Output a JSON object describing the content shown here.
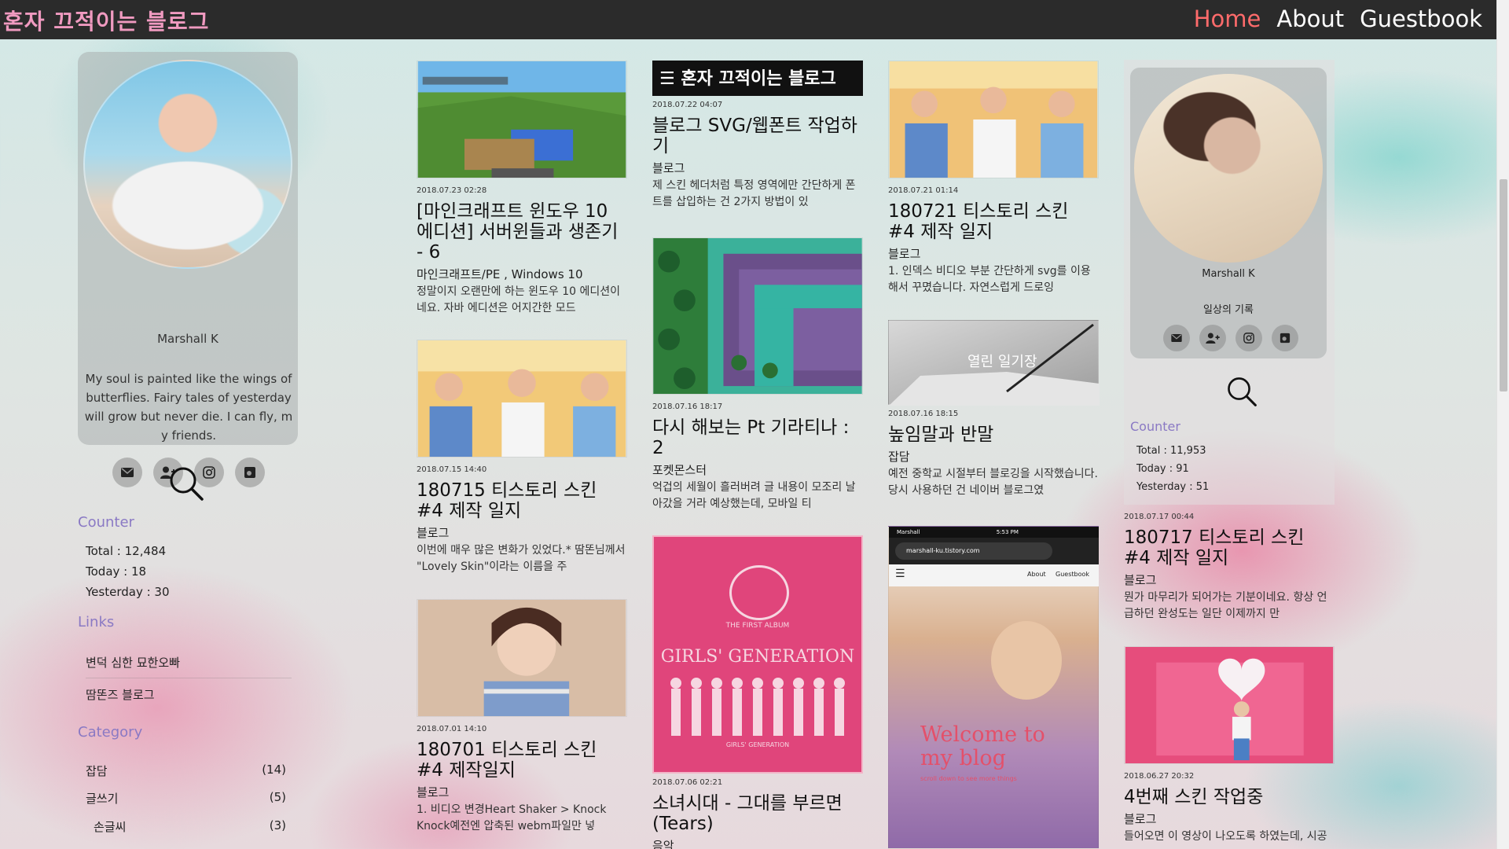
{
  "colors": {
    "topbar": "#2b2b2b",
    "logo": "#f09ac0",
    "nav_active": "#ff6b6b",
    "side_heading": "#8a79c4"
  },
  "header": {
    "logo": "혼자 끄적이는 블로그",
    "nav": [
      "Home",
      "About",
      "Guestbook"
    ]
  },
  "left_sidebar": {
    "profile_name": "Marshall K",
    "bio": "My soul is painted like the wings of butterflies. Fairy tales of yesterday will grow but never die. I can fly, my friends.",
    "icons": [
      "mail-icon",
      "add-user-icon",
      "instagram-icon",
      "tistory-icon"
    ],
    "counter": {
      "heading": "Counter",
      "total": "Total : 12,484",
      "today": "Today : 18",
      "yesterday": "Yesterday : 30"
    },
    "links": {
      "heading": "Links",
      "items": [
        "변덕 심한 묘한오빠",
        "땀똔즈 블로그"
      ]
    },
    "category": {
      "heading": "Category",
      "items": [
        {
          "name": "잡담",
          "count": "(14)"
        },
        {
          "name": "글쓰기",
          "count": "(5)"
        },
        {
          "name": "손글씨",
          "count": "(3)"
        }
      ]
    }
  },
  "posts": [
    {
      "date": "2018.07.23 02:28",
      "title": "[마인크래프트 윈도우 10 에디션] 서버윈들과 생존기 - 6",
      "category": "마인크래프트/PE , Windows 10",
      "excerpt": "정말이지 오랜만에 하는 윈도우 10 에디션이네요. 자바 에디션은 어지간한 모드"
    },
    {
      "date": "2018.07.15 14:40",
      "title": "180715 티스토리 스킨 #4 제작 일지",
      "category": "블로그",
      "excerpt": "이번에 매우 많은 변화가 있었다.* 땀똔님께서 \"Lovely Skin\"이라는 이름을 주"
    },
    {
      "date": "2018.07.01 14:10",
      "title": "180701 티스토리 스킨 #4 제작일지",
      "category": "블로그",
      "excerpt": "1. 비디오 변경Heart Shaker > Knock Knock예전엔 압축된 webm파일만 넣"
    },
    {
      "date": "2018.07.22 04:07",
      "title": "블로그 SVG/웹폰트 작업하기",
      "category": "블로그",
      "excerpt": "제 스킨 헤더처럼 특정 영역에만 간단하게 폰트를 삽입하는 건 2가지 방법이 있"
    },
    {
      "date": "2018.07.16 18:17",
      "title": "다시 해보는 Pt 기라티나 : 2",
      "category": "포켓몬스터",
      "excerpt": "억겁의 세월이 흘러버려 글 내용이 모조리 날아갔을 거라 예상했는데, 모바일 티"
    },
    {
      "date": "2018.07.06 02:21",
      "title": "소녀시대 - 그대를 부르면 (Tears)",
      "category": "음악",
      "excerpt": ""
    },
    {
      "date": "2018.07.21 01:14",
      "title": "180721 티스토리 스킨 #4 제작 일지",
      "category": "블로그",
      "excerpt": "1. 인덱스 비디오 부분 간단하게 svg를 이용해서 꾸몄습니다. 자연스럽게 드로잉"
    },
    {
      "date": "2018.07.16 18:15",
      "title": "높임말과 반말",
      "category": "잡담",
      "excerpt": "예전 중학교 시절부터 블로깅을 시작했습니다. 당시 사용하던 건 네이버 블로그였"
    },
    {
      "date": "2018.07.17 00:44",
      "title": "180717 티스토리 스킨 #4 제작 일지",
      "category": "블로그",
      "excerpt": "뭔가 마무리가 되어가는 기분이네요. 항상 언급하던 완성도는 일단 이제까지 만"
    },
    {
      "date": "2018.06.27 20:32",
      "title": "4번째 스킨 작업중",
      "category": "블로그",
      "excerpt": "들어오면 이 영상이 나오도록 하였는데, 시공을 사용하고 싶어도 시공은 영상을"
    }
  ],
  "thumb_text": {
    "svg_banner": "혼자 끄적이는 블로그",
    "diary": "열린 일기장",
    "gg_title": "GIRLS' GENERATION",
    "gg_small": "THE FIRST ALBUM",
    "gg_sub": "GIRLS' GENERATION",
    "phone_header_name": "Marshall",
    "phone_header_time": "5:53 PM",
    "phone_url": "marshall-ku.tistory.com",
    "phone_nav_about": "About",
    "phone_nav_guestbook": "Guestbook",
    "phone_welcome": "Welcome to my blog",
    "phone_scroll": "scroll down to see more things"
  },
  "right_sidebar": {
    "profile_name": "Marshall K",
    "tagline": "일상의 기록",
    "icons": [
      "mail-icon",
      "add-user-icon",
      "instagram-icon",
      "tistory-icon"
    ],
    "counter": {
      "heading": "Counter",
      "total": "Total : 11,953",
      "today": "Today : 91",
      "yesterday": "Yesterday : 51"
    }
  }
}
